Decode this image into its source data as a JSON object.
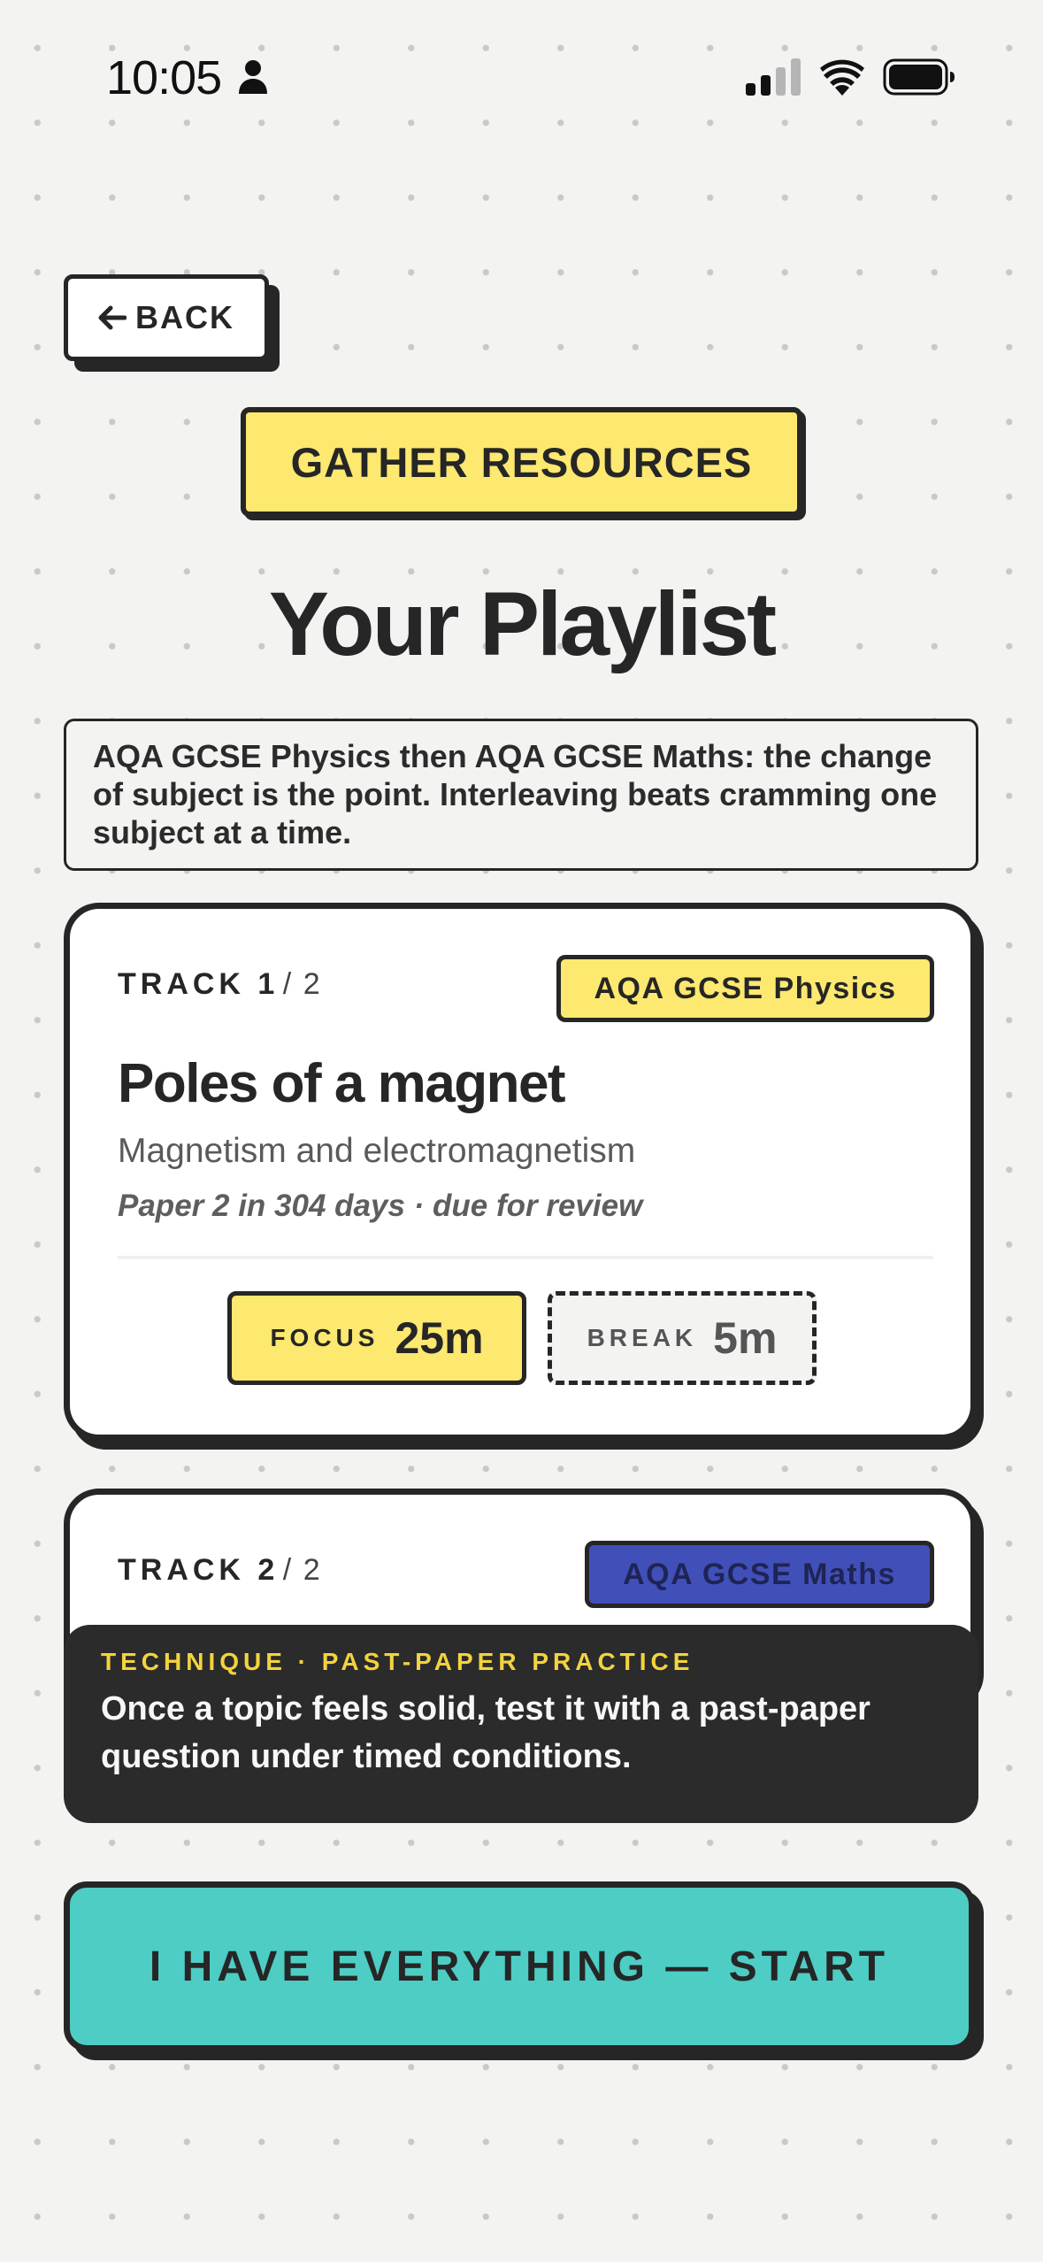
{
  "status_bar": {
    "time": "10:05",
    "icons": [
      "person-icon",
      "signal-icon",
      "wifi-icon",
      "battery-icon"
    ]
  },
  "nav": {
    "back_label": "BACK"
  },
  "header": {
    "gather_label": "GATHER RESOURCES",
    "title": "Your Playlist"
  },
  "intro": "AQA GCSE Physics then AQA GCSE Maths: the change of subject is the point. Interleaving beats cramming one subject at a time.",
  "tracks": [
    {
      "label": "TRACK 1",
      "total": "/ 2",
      "subject": "AQA GCSE Physics",
      "subject_color": "#fde870",
      "topic": "Poles of a magnet",
      "subtopic": "Magnetism and electromagnetism",
      "due": "Paper 2 in 304 days · due for review",
      "focus_label": "FOCUS",
      "focus_value": "25m",
      "break_label": "BREAK",
      "break_value": "5m"
    },
    {
      "label": "TRACK 2",
      "total": "/ 2",
      "subject": "AQA GCSE Maths",
      "subject_color": "#4150b8"
    }
  ],
  "technique": {
    "label": "TECHNIQUE · PAST-PAPER PRACTICE",
    "text": "Once a topic feels solid, test it with a past-paper question under timed conditions."
  },
  "start_label": "I HAVE EVERYTHING — START",
  "colors": {
    "background": "#f3f3f2",
    "ink": "#262626",
    "yellow": "#fde870",
    "teal": "#4ecdc4",
    "blue": "#4150b8",
    "dark": "#2b2b2b"
  }
}
